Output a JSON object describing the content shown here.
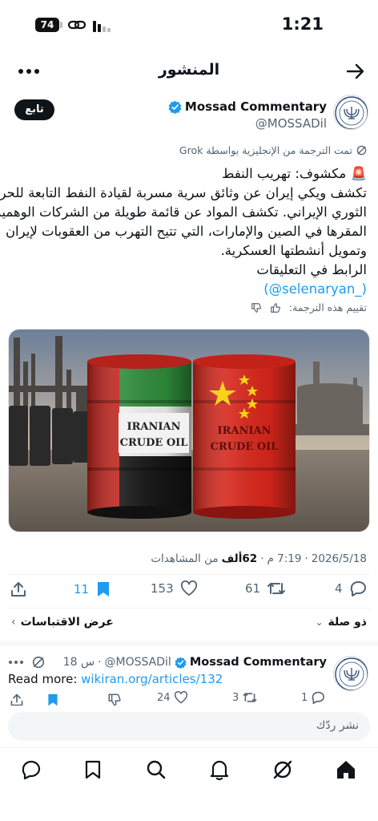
{
  "status_bar": {
    "time": "1:21",
    "battery": "74"
  },
  "header": {
    "title": "المنشور"
  },
  "post": {
    "author_name": "Mossad Commentary",
    "author_handle": "@MOSSADil",
    "follow_label": "تابع",
    "translated_note": "تمت الترجمة من الإنجليزية بواسطة Grok",
    "headline": "🚨 مكشوف: تهريب النفط",
    "body_lines": [
      "تكشف ويكي إيران عن وثائق سرية مسربة لقيادة النفط التابعة للحرس",
      "الثوري الإيراني. تكشف المواد عن قائمة طويلة من الشركات الوهمية",
      "المقرها في الصين والإمارات، التي تتيح التهرب من العقوبات لإيران",
      "وتمويل أنشطتها العسكرية.",
      "الرابط في التعليقات"
    ],
    "mention": "(@selenaryan_)",
    "rate_translation": "تقييم هذه الترجمة:",
    "image": {
      "left_barrel_text": [
        "IRANIAN",
        "CRUDE OIL"
      ],
      "right_barrel_text": [
        "IRANIAN",
        "CRUDE OIL"
      ]
    },
    "meta": {
      "date": "2026/5/18",
      "time": "7:19 م",
      "views_count": "62ألف",
      "views_label": "من المشاهدات"
    },
    "stats": {
      "bookmarks": "11",
      "likes": "153",
      "reposts": "61",
      "replies": "4"
    },
    "related_label": "ذو صلة",
    "quotes_label": "عرض الاقتباسات"
  },
  "reply": {
    "author_name": "Mossad Commentary",
    "author_handle": "@MOSSADil",
    "time_ago": "18 س",
    "text_prefix": "Read more:",
    "link": "wikiran.org/articles/132",
    "stats": {
      "likes": "24",
      "reposts": "3",
      "replies": "1"
    }
  },
  "composer": {
    "placeholder": "نشر ردّك"
  },
  "colors": {
    "accent": "#1d9bf0",
    "verified": "#1d9bf0",
    "text": "#0f1419",
    "muted": "#536471"
  },
  "icons": {
    "back": "arrow-right-icon",
    "more": "more-icon",
    "verified": "verified-badge-icon",
    "share": "share-icon",
    "bookmark": "bookmark-icon",
    "like": "heart-icon",
    "repost": "repost-icon",
    "reply": "reply-icon",
    "grok": "grok-icon",
    "nav": [
      "home-icon",
      "grok-icon",
      "notifications-icon",
      "search-icon",
      "bookmarks-icon",
      "messages-icon"
    ]
  }
}
